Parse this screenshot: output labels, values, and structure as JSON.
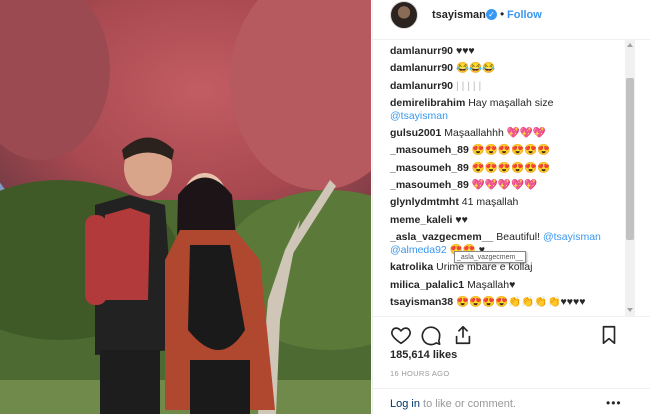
{
  "post": {
    "username": "tsayisman",
    "follow_label": "Follow",
    "dot": "•",
    "verified_mark": "✓"
  },
  "comments": [
    {
      "user": "damlanurr90",
      "text": "♥♥♥"
    },
    {
      "user": "damlanurr90",
      "text": "😂😂😂"
    },
    {
      "user": "damlanurr90",
      "text": "| | | | |"
    },
    {
      "user": "demirelibrahim",
      "text": "Hay maşallah size",
      "mention": "@tsayisman"
    },
    {
      "user": "gulsu2001",
      "text": "Maşaallahhh 💖💖💖"
    },
    {
      "user": "_masoumeh_89",
      "text": "😍😍😍😍😍😍"
    },
    {
      "user": "_masoumeh_89",
      "text": "😍😍😍😍😍😍"
    },
    {
      "user": "_masoumeh_89",
      "text": "💖💖💖💖💖"
    },
    {
      "user": "glynlydmtmht",
      "text": "41 maşallah"
    },
    {
      "user": "meme_kaleli",
      "text": "♥♥"
    },
    {
      "user": "_asla_vazgecmem__",
      "text": "Beautiful!",
      "mention": "@tsayisman",
      "mention2": "@almeda92",
      "text2": "😍😍 ♥"
    },
    {
      "user": "katrolika",
      "text": "Urime mbare e kollaj"
    },
    {
      "user": "milica_palalic1",
      "text": "Maşallah♥"
    },
    {
      "user": "tsayisman38",
      "text": "😍😍😍😍👏👏👏👏♥♥♥♥"
    }
  ],
  "tooltip": "_asla_vazgecmem__",
  "likes": "185,614 likes",
  "timestamp": "16 HOURS AGO",
  "login_link": "Log in",
  "login_text": " to like or comment.",
  "more": "•••",
  "icons": [
    "heart-icon",
    "comment-icon",
    "share-icon",
    "bookmark-icon"
  ]
}
